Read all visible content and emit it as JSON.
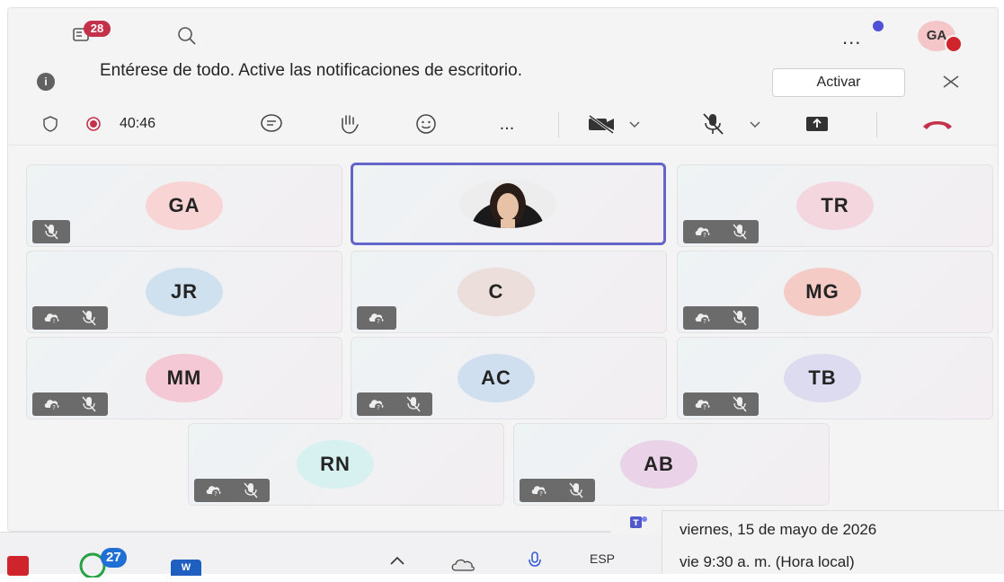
{
  "topbar": {
    "activity_badge": "28",
    "more_label": "...",
    "avatar_initials": "GA"
  },
  "notification": {
    "text": "Entérese de todo. Active las notificaciones de escritorio.",
    "button": "Activar"
  },
  "meeting": {
    "timer": "40:46",
    "more_label": "..."
  },
  "participants": [
    {
      "initials": "GA",
      "avatar_color": "#f8d4d4"
    },
    {
      "initials": "",
      "photo": true
    },
    {
      "initials": "TR",
      "avatar_color": "#f4d6df"
    },
    {
      "initials": "JR",
      "avatar_color": "#cfe0ee"
    },
    {
      "initials": "C",
      "avatar_color": "#ecdedb"
    },
    {
      "initials": "MG",
      "avatar_color": "#f5cbc6"
    },
    {
      "initials": "MM",
      "avatar_color": "#f5c8d5"
    },
    {
      "initials": "AC",
      "avatar_color": "#cfdff0"
    },
    {
      "initials": "TB",
      "avatar_color": "#dcdbef"
    },
    {
      "initials": "RN",
      "avatar_color": "#d6f1f0"
    },
    {
      "initials": "AB",
      "avatar_color": "#ead3e8"
    }
  ],
  "taskbar": {
    "whatsapp_badge": "27",
    "language": "ESP"
  },
  "popup": {
    "date": "viernes, 15 de mayo de 2026",
    "time": "vie 9:30 a. m. (Hora local)"
  }
}
